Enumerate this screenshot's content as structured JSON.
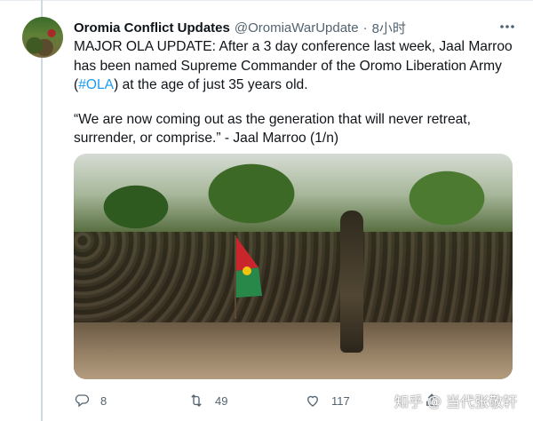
{
  "tweet": {
    "display_name": "Oromia Conflict Updates",
    "handle": "@OromiaWarUpdate",
    "separator": "·",
    "time": "8小时",
    "text_before_hashtag": "MAJOR OLA UPDATE: After a 3 day conference last week, Jaal Marroo has been named Supreme Commander of the Oromo Liberation Army (",
    "hashtag": "#OLA",
    "text_after_hashtag": ") at the age of just 35 years old.",
    "quote": "“We are now coming out as the  generation that will never retreat, surrender, or comprise.” - Jaal Marroo (1/n)"
  },
  "actions": {
    "reply_count": "8",
    "retweet_count": "49",
    "like_count": "117"
  },
  "icons": {
    "more": "more-horizontal-icon",
    "reply": "reply-icon",
    "retweet": "retweet-icon",
    "like": "heart-icon",
    "share": "share-icon"
  },
  "watermark": {
    "site": "知乎",
    "at": "@",
    "author": "当代张敬轩"
  },
  "colors": {
    "link": "#1d9bf0",
    "secondary_text": "#536471",
    "flag_red": "#c8262c",
    "flag_green": "#27884a",
    "flag_yellow": "#f1c40f"
  }
}
